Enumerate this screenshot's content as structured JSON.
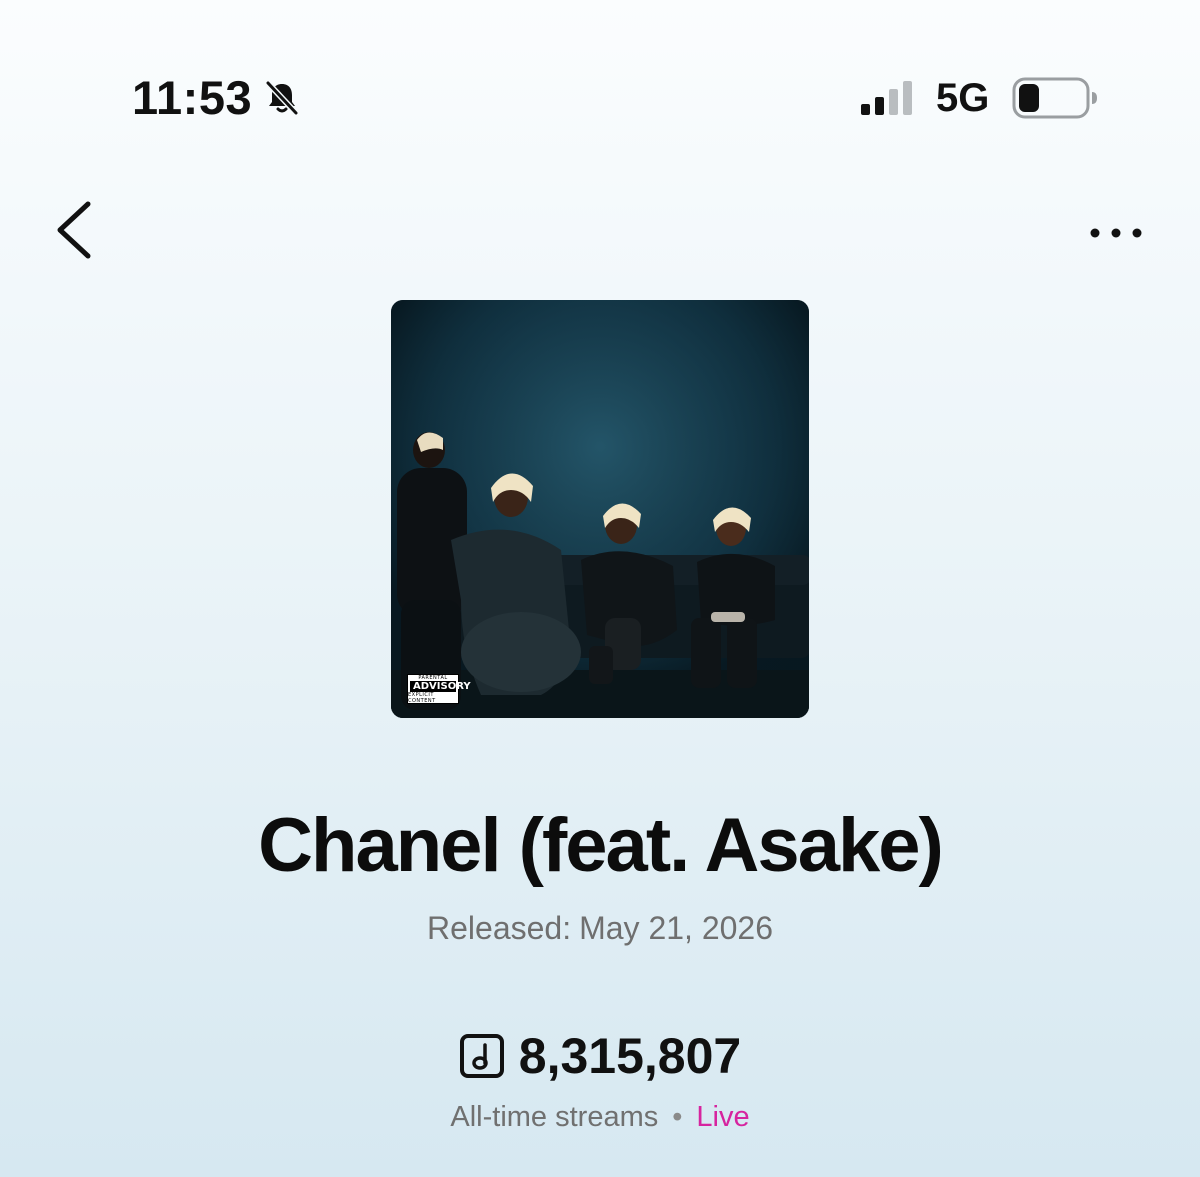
{
  "status_bar": {
    "time": "11:53",
    "network": "5G",
    "icons": [
      "bell-muted-icon",
      "signal-icon",
      "battery-icon"
    ]
  },
  "nav": {
    "back_icon": "chevron-left-icon",
    "more_icon": "more-horizontal-icon"
  },
  "album": {
    "art_icon": "album-cover",
    "advisory_top": "PARENTAL",
    "advisory_main": "ADVISORY",
    "advisory_bottom": "EXPLICIT CONTENT"
  },
  "track": {
    "title": "Chanel (feat. Asake)",
    "release_label": "Released:",
    "release_date": "May 21, 2026"
  },
  "streams": {
    "icon": "music-note-square-icon",
    "count": "8,315,807",
    "label": "All-time streams",
    "separator": "•",
    "status": "Live"
  },
  "colors": {
    "live": "#d6249f",
    "secondary_text": "#707070",
    "primary_text": "#111111"
  }
}
